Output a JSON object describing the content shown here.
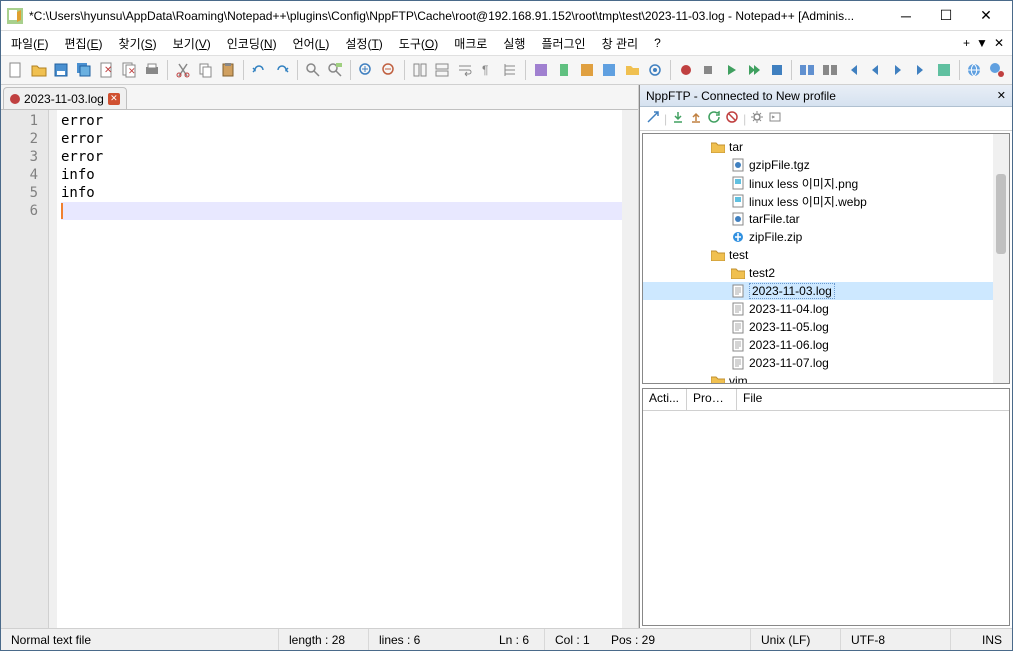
{
  "window": {
    "title": "*C:\\Users\\hyunsu\\AppData\\Roaming\\Notepad++\\plugins\\Config\\NppFTP\\Cache\\root@192.168.91.152\\root\\tmp\\test\\2023-11-03.log - Notepad++ [Adminis..."
  },
  "menu": {
    "items": [
      {
        "label": "파일",
        "key": "F"
      },
      {
        "label": "편집",
        "key": "E"
      },
      {
        "label": "찾기",
        "key": "S"
      },
      {
        "label": "보기",
        "key": "V"
      },
      {
        "label": "인코딩",
        "key": "N"
      },
      {
        "label": "언어",
        "key": "L"
      },
      {
        "label": "설정",
        "key": "T"
      },
      {
        "label": "도구",
        "key": "O"
      },
      {
        "label": "매크로",
        "key": ""
      },
      {
        "label": "실행",
        "key": ""
      },
      {
        "label": "플러그인",
        "key": ""
      },
      {
        "label": "창 관리",
        "key": ""
      },
      {
        "label": "?",
        "key": ""
      }
    ],
    "plus": "+"
  },
  "tab": {
    "name": "2023-11-03.log"
  },
  "editor": {
    "lines": [
      "error",
      "error",
      "error",
      "info",
      "info",
      ""
    ],
    "current_line_index": 5
  },
  "ftp": {
    "title": "NppFTP - Connected to New profile",
    "tree": [
      {
        "type": "folder",
        "name": "tar",
        "depth": 0
      },
      {
        "type": "file",
        "name": "gzipFile.tgz",
        "icon": "archive",
        "depth": 1
      },
      {
        "type": "file",
        "name": "linux less 이미지.png",
        "icon": "image",
        "depth": 1
      },
      {
        "type": "file",
        "name": "linux less 이미지.webp",
        "icon": "image",
        "depth": 1
      },
      {
        "type": "file",
        "name": "tarFile.tar",
        "icon": "archive",
        "depth": 1
      },
      {
        "type": "file",
        "name": "zipFile.zip",
        "icon": "zip",
        "depth": 1
      },
      {
        "type": "folder",
        "name": "test",
        "depth": 0
      },
      {
        "type": "folder",
        "name": "test2",
        "depth": 1
      },
      {
        "type": "file",
        "name": "2023-11-03.log",
        "icon": "text",
        "depth": 1,
        "selected": true
      },
      {
        "type": "file",
        "name": "2023-11-04.log",
        "icon": "text",
        "depth": 1
      },
      {
        "type": "file",
        "name": "2023-11-05.log",
        "icon": "text",
        "depth": 1
      },
      {
        "type": "file",
        "name": "2023-11-06.log",
        "icon": "text",
        "depth": 1
      },
      {
        "type": "file",
        "name": "2023-11-07.log",
        "icon": "text",
        "depth": 1
      },
      {
        "type": "folder",
        "name": "vim",
        "depth": 0
      }
    ],
    "queue_cols": [
      "Acti...",
      "Progr...",
      "File"
    ]
  },
  "status": {
    "type": "Normal text file",
    "length": "length : 28",
    "lines": "lines : 6",
    "ln": "Ln : 6",
    "col": "Col : 1",
    "pos": "Pos : 29",
    "eol": "Unix (LF)",
    "enc": "UTF-8",
    "ins": "INS"
  }
}
